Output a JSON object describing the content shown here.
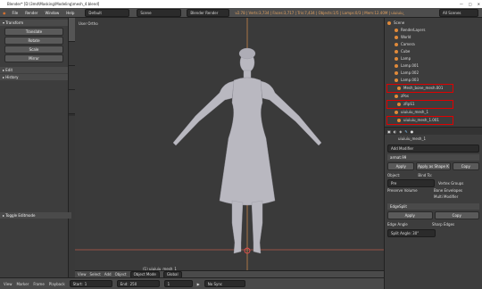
{
  "window": {
    "title": "Blender* [D:\\3md\\Masking\\Modeling\\mesh_4.blend]"
  },
  "menubar": {
    "items": [
      "File",
      "Render",
      "Window",
      "Help"
    ],
    "layout_value": "Default",
    "scene_value": "Scene",
    "render_engine": "Blender Render",
    "stats": "v2.78 | Verts:3,734 | Faces:3,717 | Tris:7,434 | Objects:1/5 | Lamps:0/3 | Mem:12.40M | uiuiuiu_mesh_1",
    "search_value": "All Scenes"
  },
  "toolshelf": {
    "transform_header": "▾ Transform",
    "buttons": [
      "Translate",
      "Rotate",
      "Scale",
      "Mirror"
    ],
    "edit_header": "▸ Edit",
    "history_header": "▸ History",
    "toggle_label": "▸ Toggle Editmode",
    "tabs": [
      "Tools",
      "Create",
      "Relations",
      "Animation"
    ]
  },
  "viewport": {
    "label": "User Ortho",
    "object_label": "(1) uiuiuiu_mesh_1"
  },
  "header3d": {
    "view": "View",
    "select": "Select",
    "add": "Add",
    "object": "Object",
    "mode": "Object Mode",
    "pivot": "Global"
  },
  "timeline": {
    "view": "View",
    "marker": "Marker",
    "frame": "Frame",
    "playback": "Playback",
    "start": "Start:",
    "start_val": "1",
    "end": "End:",
    "end_val": "250",
    "current": "1",
    "sync": "No Sync"
  },
  "outliner": {
    "items": [
      {
        "label": "Scene",
        "indent": 0,
        "highlight": false
      },
      {
        "label": "RenderLayers",
        "indent": 1,
        "highlight": false
      },
      {
        "label": "World",
        "indent": 1,
        "highlight": false
      },
      {
        "label": "Camera",
        "indent": 1,
        "highlight": false
      },
      {
        "label": "Cube",
        "indent": 1,
        "highlight": false
      },
      {
        "label": "Lamp",
        "indent": 1,
        "highlight": false
      },
      {
        "label": "Lamp.001",
        "indent": 1,
        "highlight": false
      },
      {
        "label": "Lamp.002",
        "indent": 1,
        "highlight": false
      },
      {
        "label": "Lamp.003",
        "indent": 1,
        "highlight": false
      },
      {
        "label": "Mesh_bone_mesh.001",
        "indent": 1,
        "highlight": true
      },
      {
        "label": "zPos",
        "indent": 1,
        "highlight": false
      },
      {
        "label": "zRpS1",
        "indent": 1,
        "highlight": true
      },
      {
        "label": "uiuiuiu_mesh_1",
        "indent": 1,
        "highlight": false
      },
      {
        "label": "uiuiuiu_mesh_1.001",
        "indent": 1,
        "highlight": true
      }
    ]
  },
  "props": {
    "object_name": "uiuiuiu_mesh_1",
    "add_modifier": "Add Modifier",
    "mod1": {
      "name": "armat.99",
      "apply": "Apply",
      "apply_shape": "Apply as Shape K",
      "copy": "Copy",
      "object_label": "Object:",
      "object_value": "Pre",
      "bind_to": "Bind To:",
      "preserve": "Preserve Volume",
      "vertex_groups": "Vertex Groups",
      "bone_env": "Bone Envelopes",
      "multi": "Multi Modifier"
    },
    "mod2": {
      "name": "EdgeSplit",
      "apply": "Apply",
      "copy": "Copy",
      "edge_angle": "Edge Angle",
      "sharp_edges": "Sharp Edges",
      "split_angle": "Split Angle: 30°"
    }
  }
}
